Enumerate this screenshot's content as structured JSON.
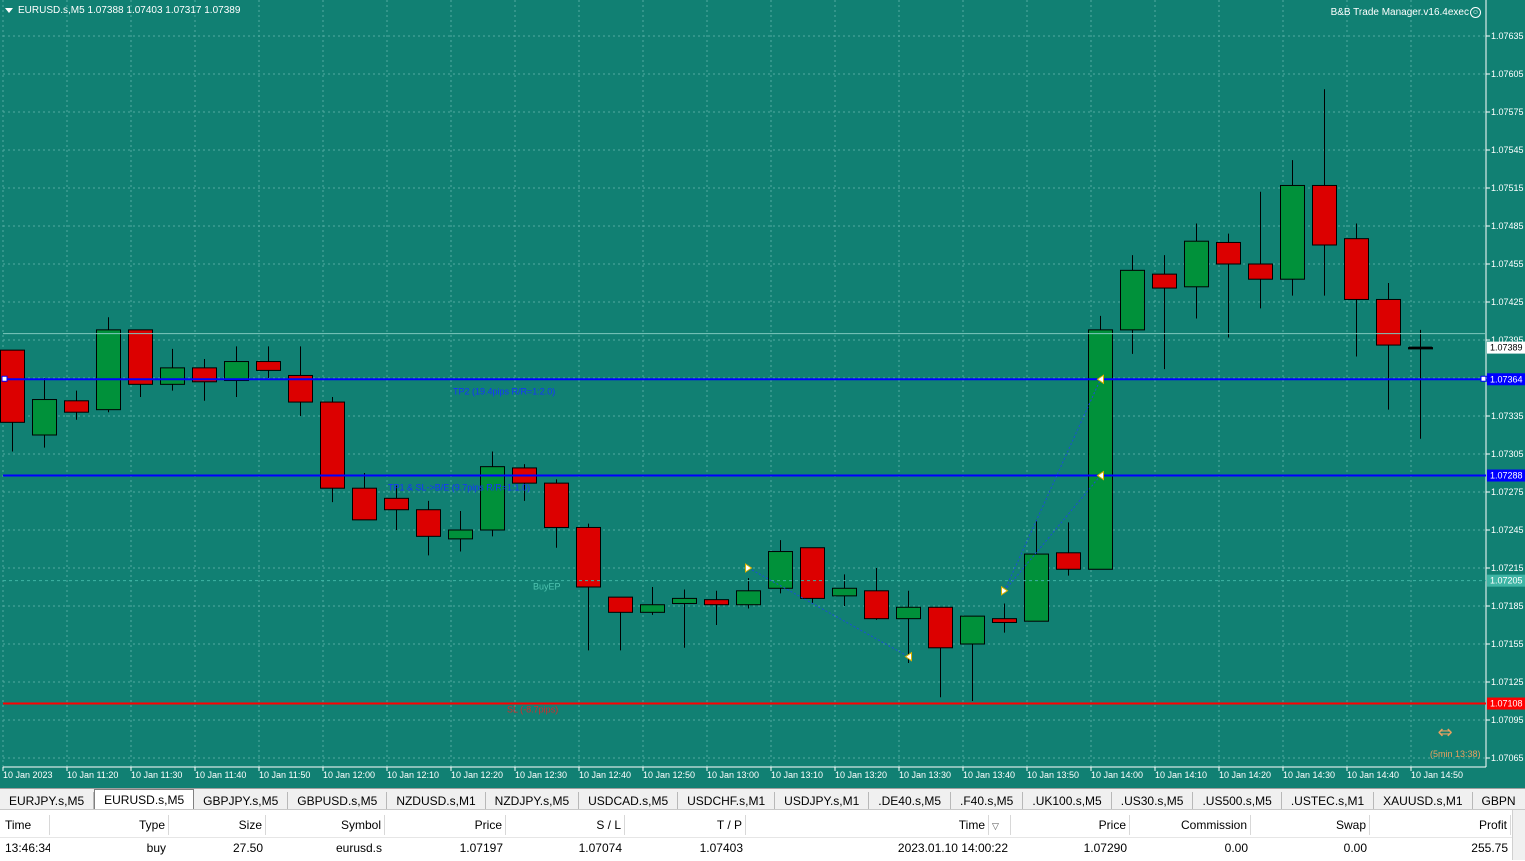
{
  "chart": {
    "title": "EURUSD.s,M5  1.07388 1.07403 1.07317 1.07389",
    "ea_label": "B&B Trade Manager.v16.4exec",
    "colors": {
      "background": "#118073",
      "grid": "#52aaa0",
      "axis_text": "#ffffff",
      "bull": "#00913a",
      "bear": "#dc0000",
      "wick": "#000000",
      "tp_line": "#0000ff",
      "sl_line": "#ff0000",
      "label_tp": "#1633ff",
      "label_sl": "#d42a2a",
      "label_ep": "#4fc3b0",
      "last_price_tag": "#ffffff"
    },
    "y_axis": {
      "min": 1.07065,
      "max": 1.07635,
      "ticks": [
        "1.07635",
        "1.07605",
        "1.07575",
        "1.07545",
        "1.07515",
        "1.07485",
        "1.07455",
        "1.07425",
        "1.07395",
        "1.07365",
        "1.07335",
        "1.07305",
        "1.07275",
        "1.07245",
        "1.07215",
        "1.07185",
        "1.07155",
        "1.07125",
        "1.07095",
        "1.07065"
      ]
    },
    "x_axis": {
      "labels": [
        "10 Jan 2023",
        "10 Jan 11:20",
        "10 Jan 11:30",
        "10 Jan 11:40",
        "10 Jan 11:50",
        "10 Jan 12:00",
        "10 Jan 12:10",
        "10 Jan 12:20",
        "10 Jan 12:30",
        "10 Jan 12:40",
        "10 Jan 12:50",
        "10 Jan 13:00",
        "10 Jan 13:10",
        "10 Jan 13:20",
        "10 Jan 13:30",
        "10 Jan 13:40",
        "10 Jan 13:50",
        "10 Jan 14:00",
        "10 Jan 14:10",
        "10 Jan 14:20",
        "10 Jan 14:30",
        "10 Jan 14:40",
        "10 Jan 14:50"
      ]
    },
    "price_tags": {
      "last": "1.07389",
      "tp2": "1.07364",
      "tp1": "1.07288",
      "ep": "1.07205",
      "sl": "1.07108"
    },
    "lines": {
      "tp2": {
        "price": 1.07364,
        "label": "TP2 (19.4pips R/R=1:2.0)"
      },
      "tp1": {
        "price": 1.07288,
        "label": "TP1 & SL->B/E (9.7pips R/R=1:1.0)"
      },
      "ep": {
        "price": 1.07205,
        "label": "BuyEP"
      },
      "sl": {
        "price": 1.07108,
        "label": "SL (-8.7pips)"
      }
    },
    "countdown": "(5min 13:38)",
    "countdown_icon": "double-arrow-icon",
    "candles": [
      {
        "o": 1.07387,
        "h": 1.07387,
        "l": 1.07307,
        "c": 1.0733
      },
      {
        "o": 1.0732,
        "h": 1.07365,
        "l": 1.0731,
        "c": 1.07348
      },
      {
        "o": 1.07347,
        "h": 1.07355,
        "l": 1.07332,
        "c": 1.07338
      },
      {
        "o": 1.0734,
        "h": 1.07413,
        "l": 1.07338,
        "c": 1.07403
      },
      {
        "o": 1.07403,
        "h": 1.07403,
        "l": 1.0735,
        "c": 1.0736
      },
      {
        "o": 1.0736,
        "h": 1.07388,
        "l": 1.07355,
        "c": 1.07373
      },
      {
        "o": 1.07373,
        "h": 1.0738,
        "l": 1.07347,
        "c": 1.07362
      },
      {
        "o": 1.07363,
        "h": 1.0739,
        "l": 1.0735,
        "c": 1.07378
      },
      {
        "o": 1.07378,
        "h": 1.0739,
        "l": 1.07365,
        "c": 1.07371
      },
      {
        "o": 1.07367,
        "h": 1.0739,
        "l": 1.07335,
        "c": 1.07346
      },
      {
        "o": 1.07346,
        "h": 1.0735,
        "l": 1.07267,
        "c": 1.07278
      },
      {
        "o": 1.07278,
        "h": 1.0729,
        "l": 1.07262,
        "c": 1.07253
      },
      {
        "o": 1.0727,
        "h": 1.0728,
        "l": 1.07245,
        "c": 1.07261
      },
      {
        "o": 1.07261,
        "h": 1.07268,
        "l": 1.07225,
        "c": 1.0724
      },
      {
        "o": 1.07238,
        "h": 1.0726,
        "l": 1.07228,
        "c": 1.07245
      },
      {
        "o": 1.07245,
        "h": 1.07307,
        "l": 1.0724,
        "c": 1.07295
      },
      {
        "o": 1.07294,
        "h": 1.07297,
        "l": 1.07268,
        "c": 1.07282
      },
      {
        "o": 1.07282,
        "h": 1.07285,
        "l": 1.07231,
        "c": 1.07247
      },
      {
        "o": 1.07247,
        "h": 1.0725,
        "l": 1.0715,
        "c": 1.072
      },
      {
        "o": 1.07192,
        "h": 1.07192,
        "l": 1.0715,
        "c": 1.0718
      },
      {
        "o": 1.0718,
        "h": 1.072,
        "l": 1.07178,
        "c": 1.07186
      },
      {
        "o": 1.07187,
        "h": 1.07198,
        "l": 1.07152,
        "c": 1.07191
      },
      {
        "o": 1.0719,
        "h": 1.07197,
        "l": 1.0717,
        "c": 1.07186
      },
      {
        "o": 1.07186,
        "h": 1.07207,
        "l": 1.07183,
        "c": 1.07197
      },
      {
        "o": 1.07199,
        "h": 1.07237,
        "l": 1.07195,
        "c": 1.07228
      },
      {
        "o": 1.07231,
        "h": 1.07231,
        "l": 1.07187,
        "c": 1.07191
      },
      {
        "o": 1.07193,
        "h": 1.0721,
        "l": 1.07185,
        "c": 1.07199
      },
      {
        "o": 1.07197,
        "h": 1.07215,
        "l": 1.07174,
        "c": 1.07175
      },
      {
        "o": 1.07175,
        "h": 1.07197,
        "l": 1.0714,
        "c": 1.07184
      },
      {
        "o": 1.07184,
        "h": 1.07184,
        "l": 1.07113,
        "c": 1.07152
      },
      {
        "o": 1.07155,
        "h": 1.07177,
        "l": 1.0711,
        "c": 1.07177
      },
      {
        "o": 1.07175,
        "h": 1.07187,
        "l": 1.07164,
        "c": 1.07172
      },
      {
        "o": 1.07173,
        "h": 1.07253,
        "l": 1.07173,
        "c": 1.07226
      },
      {
        "o": 1.07227,
        "h": 1.07251,
        "l": 1.07209,
        "c": 1.07214
      },
      {
        "o": 1.07214,
        "h": 1.07414,
        "l": 1.07214,
        "c": 1.07403
      },
      {
        "o": 1.07403,
        "h": 1.07462,
        "l": 1.07384,
        "c": 1.0745
      },
      {
        "o": 1.07447,
        "h": 1.07462,
        "l": 1.07372,
        "c": 1.07436
      },
      {
        "o": 1.07437,
        "h": 1.07487,
        "l": 1.07412,
        "c": 1.07473
      },
      {
        "o": 1.07472,
        "h": 1.07479,
        "l": 1.07397,
        "c": 1.07455
      },
      {
        "o": 1.07455,
        "h": 1.07512,
        "l": 1.0742,
        "c": 1.07443
      },
      {
        "o": 1.07443,
        "h": 1.07537,
        "l": 1.0743,
        "c": 1.07517
      },
      {
        "o": 1.07517,
        "h": 1.07593,
        "l": 1.0743,
        "c": 1.0747
      },
      {
        "o": 1.07475,
        "h": 1.07487,
        "l": 1.07382,
        "c": 1.07427
      },
      {
        "o": 1.07427,
        "h": 1.0744,
        "l": 1.0734,
        "c": 1.07391
      },
      {
        "o": 1.07388,
        "h": 1.07403,
        "l": 1.07317,
        "c": 1.07389
      }
    ]
  },
  "symbol_tabs": [
    "EURJPY.s,M5",
    "EURUSD.s,M5",
    "GBPJPY.s,M5",
    "GBPUSD.s,M5",
    "NZDUSD.s,M1",
    "NZDJPY.s,M5",
    "USDCAD.s,M5",
    "USDCHF.s,M1",
    "USDJPY.s,M1",
    ".DE40.s,M5",
    ".F40.s,M5",
    ".UK100.s,M5",
    ".US30.s,M5",
    ".US500.s,M5",
    ".USTEC.s,M1",
    "XAUUSD.s,M1",
    "GBPNZD.s"
  ],
  "active_tab": 1,
  "trades": {
    "headers": {
      "time": "Time",
      "type": "Type",
      "size": "Size",
      "symbol": "Symbol",
      "price": "Price",
      "sl": "S / L",
      "tp": "T / P",
      "close_time": "Time",
      "close_price": "Price",
      "commission": "Commission",
      "swap": "Swap",
      "profit": "Profit"
    },
    "row": {
      "time": "13:46:34",
      "type": "buy",
      "size": "27.50",
      "symbol": "eurusd.s",
      "price": "1.07197",
      "sl": "1.07074",
      "tp": "1.07403",
      "close_time": "2023.01.10 14:00:22",
      "close_price": "1.07290",
      "commission": "0.00",
      "swap": "0.00",
      "profit": "255.75"
    }
  }
}
